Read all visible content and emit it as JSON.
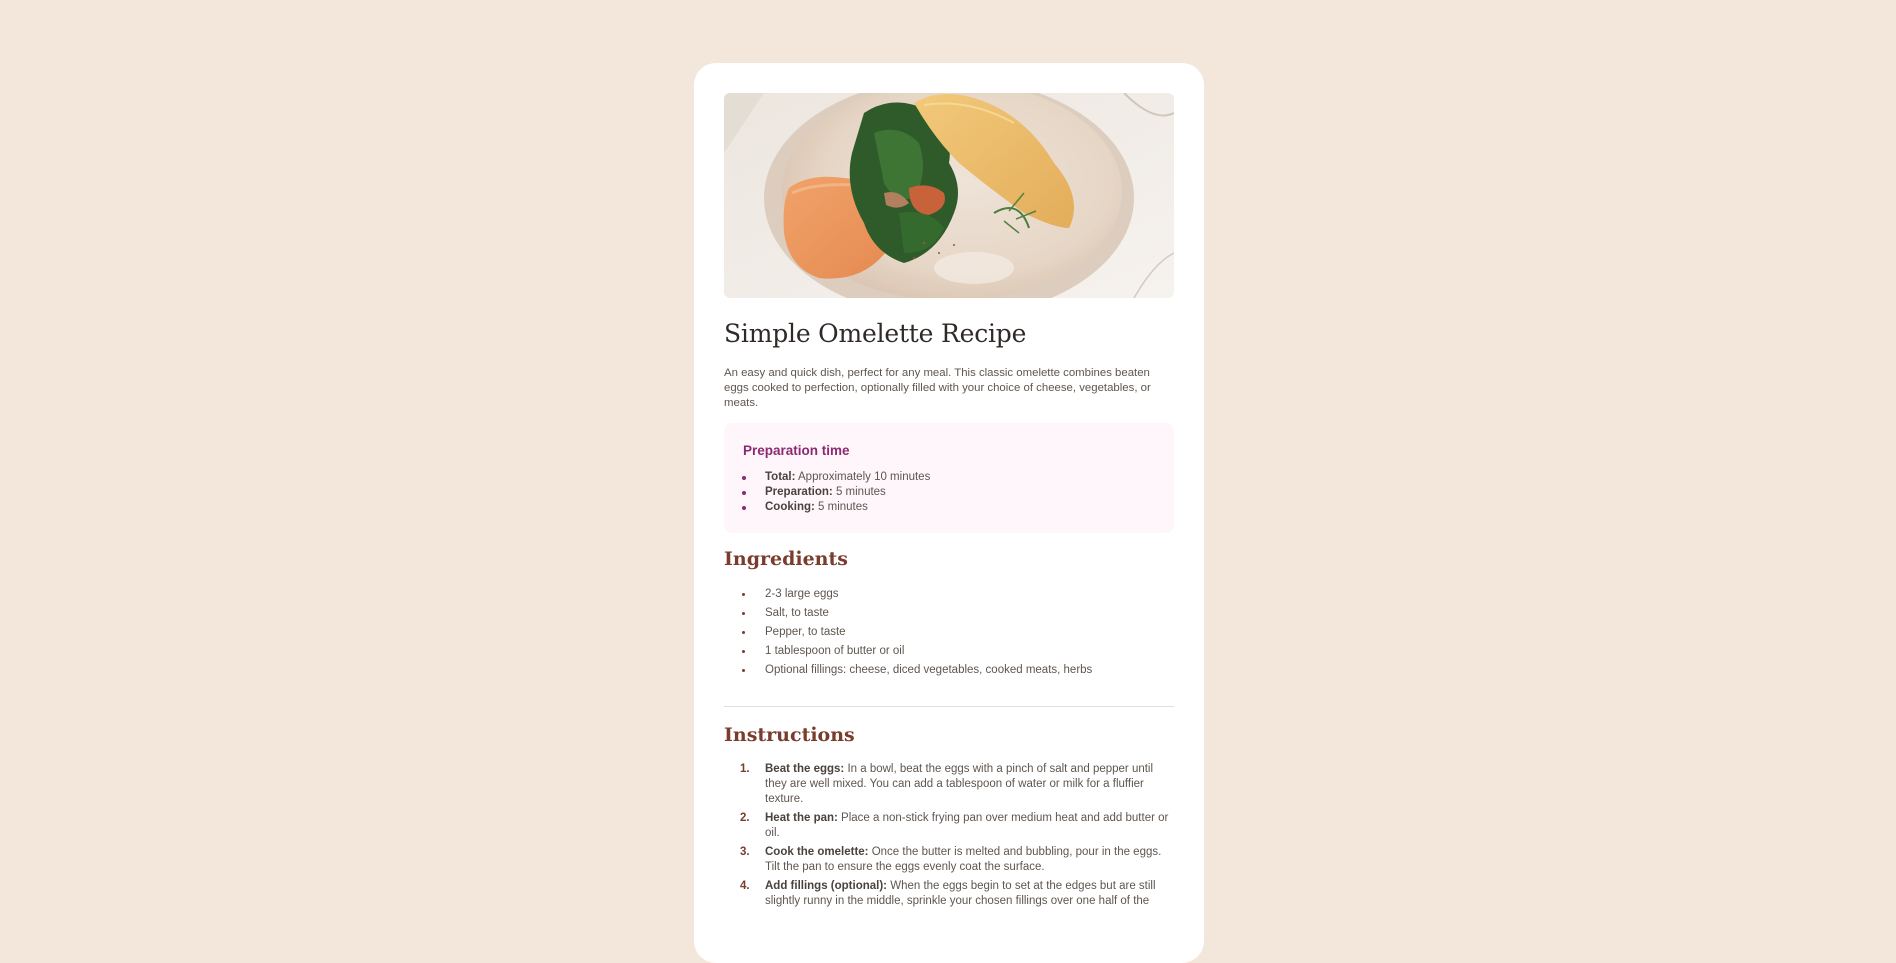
{
  "recipe": {
    "image_alt": "omelette-photo",
    "title": "Simple Omelette Recipe",
    "description": "An easy and quick dish, perfect for any meal. This classic omelette combines beaten eggs cooked to perfection, optionally filled with your choice of cheese, vegetables, or meats."
  },
  "prep": {
    "heading": "Preparation time",
    "items": [
      {
        "label": "Total:",
        "value": " Approximately 10 minutes"
      },
      {
        "label": "Preparation:",
        "value": " 5 minutes"
      },
      {
        "label": "Cooking:",
        "value": " 5 minutes"
      }
    ]
  },
  "ingredients": {
    "heading": "Ingredients",
    "items": [
      "2-3 large eggs",
      "Salt, to taste",
      "Pepper, to taste",
      "1 tablespoon of butter or oil",
      "Optional fillings: cheese, diced vegetables, cooked meats, herbs"
    ]
  },
  "instructions": {
    "heading": "Instructions",
    "steps": [
      {
        "num": "1.",
        "label": "Beat the eggs:",
        "text": " In a bowl, beat the eggs with a pinch of salt and pepper until they are well mixed. You can add a tablespoon of water or milk for a fluffier texture."
      },
      {
        "num": "2.",
        "label": "Heat the pan:",
        "text": " Place a non-stick frying pan over medium heat and add butter or oil."
      },
      {
        "num": "3.",
        "label": "Cook the omelette:",
        "text": " Once the butter is melted and bubbling, pour in the eggs. Tilt the pan to ensure the eggs evenly coat the surface."
      },
      {
        "num": "4.",
        "label": "Add fillings (optional):",
        "text": " When the eggs begin to set at the edges but are still slightly runny in the middle, sprinkle your chosen fillings over one half of the"
      }
    ]
  },
  "colors": {
    "page_bg": "#F3E6DB",
    "card_bg": "#FFFFFF",
    "accent_plum": "#8A2A72",
    "accent_brown": "#7A3D2D",
    "prep_bg": "#FFF6FB"
  }
}
